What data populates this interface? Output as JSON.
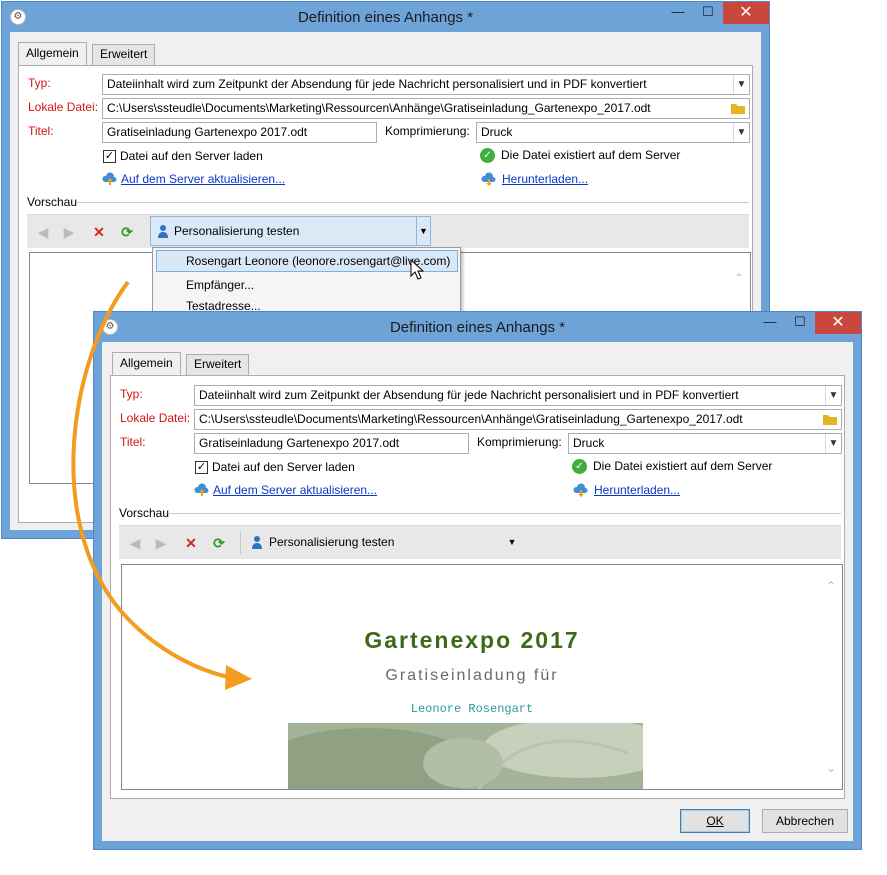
{
  "back_window": {
    "title": "Definition eines Anhangs *",
    "tabs": [
      "Allgemein",
      "Erweitert"
    ],
    "fields": {
      "type_label": "Typ:",
      "type_value": "Dateiinhalt wird zum Zeitpunkt der Absendung für jede Nachricht personalisiert und in PDF konvertiert",
      "local_file_label": "Lokale Datei:",
      "local_file_value": "C:\\Users\\ssteudle\\Documents\\Marketing\\Ressourcen\\Anhänge\\Gratiseinladung_Gartenexpo_2017.odt",
      "title_label": "Titel:",
      "title_value": "Gratiseinladung Gartenexpo 2017.odt",
      "compression_label": "Komprimierung:",
      "compression_value": "Druck",
      "upload_checkbox": "Datei auf den Server laden",
      "upload_checked": true,
      "file_exists": "Die Datei existiert auf dem Server",
      "update_link": "Auf dem Server aktualisieren...",
      "download_link": "Herunterladen..."
    },
    "preview_label": "Vorschau",
    "personalize_label": "Personalisierung testen",
    "dropdown_items": [
      "Rosengart Leonore (leonore.rosengart@live.com)",
      "Empfänger...",
      "Testadresse..."
    ]
  },
  "front_window": {
    "title": "Definition eines Anhangs *",
    "tabs": [
      "Allgemein",
      "Erweitert"
    ],
    "fields": {
      "type_label": "Typ:",
      "type_value": "Dateiinhalt wird zum Zeitpunkt der Absendung für jede Nachricht personalisiert und in PDF konvertiert",
      "local_file_label": "Lokale Datei:",
      "local_file_value": "C:\\Users\\ssteudle\\Documents\\Marketing\\Ressourcen\\Anhänge\\Gratiseinladung_Gartenexpo_2017.odt",
      "title_label": "Titel:",
      "title_value": "Gratiseinladung Gartenexpo 2017.odt",
      "compression_label": "Komprimierung:",
      "compression_value": "Druck",
      "upload_checkbox": "Datei auf den Server laden",
      "upload_checked": true,
      "file_exists": "Die Datei existiert auf dem Server",
      "update_link": "Auf dem Server aktualisieren...",
      "download_link": "Herunterladen..."
    },
    "preview_label": "Vorschau",
    "personalize_label": "Personalisierung testen",
    "preview": {
      "heading": "Gartenexpo 2017",
      "subheading": "Gratiseinladung für",
      "recipient": "Leonore Rosengart"
    },
    "ok_label": "OK",
    "cancel_label": "Abbrechen"
  },
  "colors": {
    "window_frame": "#6ea3d8",
    "close_button": "#c9473c",
    "required_label": "#d61515",
    "link": "#0b36c8",
    "arrow": "#f39c1f",
    "heading_green": "#3c6a1a",
    "recipient_teal": "#2a9a98"
  }
}
